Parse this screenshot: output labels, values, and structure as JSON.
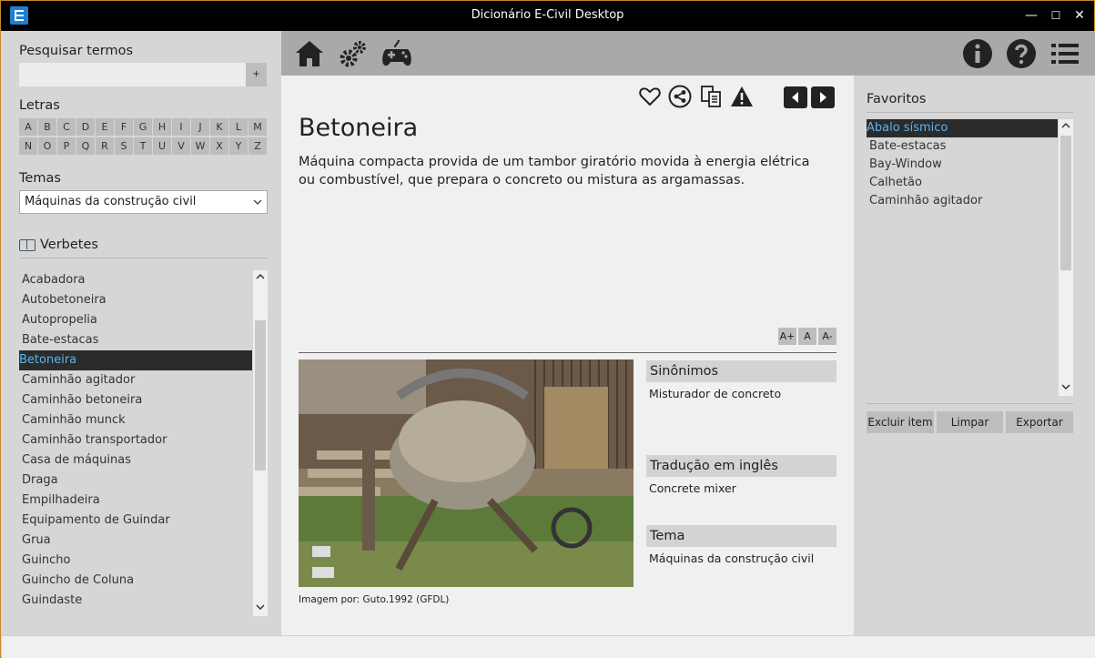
{
  "window": {
    "title": "Dicionário E-Civil Desktop",
    "minimize": "—",
    "maximize": "☐",
    "close": "✕"
  },
  "left": {
    "search_label": "Pesquisar termos",
    "search_value": "",
    "search_button": "+",
    "letters_label": "Letras",
    "letters": [
      "A",
      "B",
      "C",
      "D",
      "E",
      "F",
      "G",
      "H",
      "I",
      "J",
      "K",
      "L",
      "M",
      "N",
      "O",
      "P",
      "Q",
      "R",
      "S",
      "T",
      "U",
      "V",
      "W",
      "X",
      "Y",
      "Z"
    ],
    "themes_label": "Temas",
    "theme_selected": "Máquinas da construção civil",
    "verbetes_label": "Verbetes",
    "verbetes": [
      "Acabadora",
      "Autobetoneira",
      "Autopropelia",
      "Bate-estacas",
      "Betoneira",
      "Caminhão agitador",
      "Caminhão betoneira",
      "Caminhão munck",
      "Caminhão transportador",
      "Casa de máquinas",
      "Draga",
      "Empilhadeira",
      "Equipamento de Guindar",
      "Grua",
      "Guincho",
      "Guincho de Coluna",
      "Guindaste"
    ],
    "verbete_selected": "Betoneira"
  },
  "toolbar": {
    "icons": [
      "home-icon",
      "gears-icon",
      "gamepad-icon",
      "info-icon",
      "help-icon",
      "menu-icon"
    ]
  },
  "term": {
    "title": "Betoneira",
    "definition": "Máquina compacta provida de um tambor giratório movida à energia elétrica ou combustível, que prepara o concreto ou mistura as argamassas.",
    "font_buttons": [
      "A+",
      "A",
      "A-"
    ],
    "image_caption": "Imagem por: Guto.1992 (GFDL)",
    "synonyms_label": "Sinônimos",
    "synonyms": "Misturador de concreto",
    "translation_label": "Tradução em inglês",
    "translation": "Concrete mixer",
    "theme_label": "Tema",
    "theme": "Máquinas da construção civil"
  },
  "favorites": {
    "title": "Favoritos",
    "items": [
      "Abalo sísmico",
      "Bate-estacas",
      "Bay-Window",
      "Calhetão",
      "Caminhão agitador"
    ],
    "selected": "Abalo sísmico",
    "buttons": {
      "delete": "Excluir item",
      "clear": "Limpar",
      "export": "Exportar"
    }
  }
}
